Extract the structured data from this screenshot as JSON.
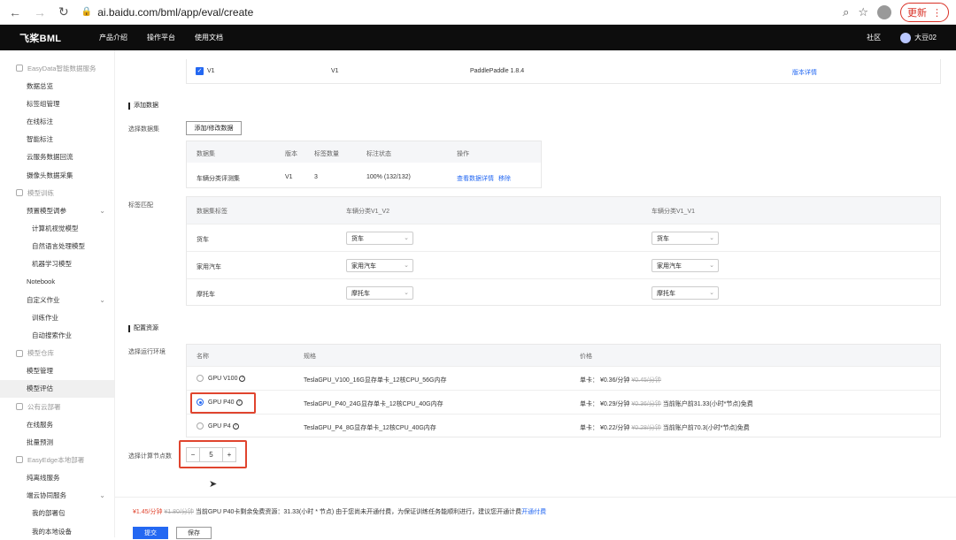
{
  "browser": {
    "url": "ai.baidu.com/bml/app/eval/create",
    "update_label": "更新"
  },
  "topbar": {
    "logo": "飞桨BML",
    "menu": [
      "产品介绍",
      "操作平台",
      "使用文档"
    ],
    "community": "社区",
    "user": "大豆02"
  },
  "sidebar": {
    "items": [
      {
        "type": "group",
        "label": "EasyData智能数据服务"
      },
      {
        "type": "item",
        "label": "数据总览"
      },
      {
        "type": "item",
        "label": "标签组管理"
      },
      {
        "type": "item",
        "label": "在线标注"
      },
      {
        "type": "item",
        "label": "智能标注"
      },
      {
        "type": "item",
        "label": "云服务数据回流"
      },
      {
        "type": "item",
        "label": "摄像头数据采集"
      },
      {
        "type": "group",
        "label": "模型训练"
      },
      {
        "type": "item",
        "label": "预置模型调参",
        "chevron": true
      },
      {
        "type": "sub",
        "label": "计算机视觉模型"
      },
      {
        "type": "sub",
        "label": "自然语言处理模型"
      },
      {
        "type": "sub",
        "label": "机器学习模型"
      },
      {
        "type": "item",
        "label": "Notebook"
      },
      {
        "type": "item",
        "label": "自定义作业",
        "chevron": true
      },
      {
        "type": "sub",
        "label": "训练作业"
      },
      {
        "type": "sub",
        "label": "自动搜索作业"
      },
      {
        "type": "group",
        "label": "模型仓库"
      },
      {
        "type": "item",
        "label": "模型管理"
      },
      {
        "type": "item",
        "label": "模型评估",
        "active": true
      },
      {
        "type": "group",
        "label": "公有云部署"
      },
      {
        "type": "item",
        "label": "在线服务"
      },
      {
        "type": "item",
        "label": "批量预测"
      },
      {
        "type": "group",
        "label": "EasyEdge本地部署"
      },
      {
        "type": "item",
        "label": "纯离线服务"
      },
      {
        "type": "item",
        "label": "端云协同服务",
        "chevron": true
      },
      {
        "type": "sub",
        "label": "我的部署包"
      },
      {
        "type": "sub",
        "label": "我的本地设备"
      }
    ]
  },
  "version_row": {
    "checked_label": "V1",
    "version": "V1",
    "framework": "PaddlePaddle 1.8.4",
    "detail_link": "版本详情"
  },
  "dataset_section": {
    "title": "添加数据",
    "select_label": "选择数据集",
    "add_button": "添加/修改数据",
    "headers": [
      "数据集",
      "版本",
      "标签数量",
      "标注状态",
      "操作"
    ],
    "row": {
      "name": "车辆分类评测集",
      "version": "V1",
      "count": "3",
      "status": "100% (132/132)",
      "view_link": "查看数据详情",
      "remove_link": "移除"
    }
  },
  "label_match": {
    "label": "标签匹配",
    "headers": [
      "数据集标签",
      "车辆分类V1_V2",
      "车辆分类V1_V1"
    ],
    "rows": [
      {
        "label": "货车",
        "v2": "货车",
        "v1": "货车"
      },
      {
        "label": "家用汽车",
        "v2": "家用汽车",
        "v1": "家用汽车"
      },
      {
        "label": "摩托车",
        "v2": "摩托车",
        "v1": "摩托车"
      }
    ]
  },
  "resource_section": {
    "title": "配置资源",
    "env_label": "选择运行环境",
    "headers": [
      "名称",
      "规格",
      "价格"
    ],
    "rows": [
      {
        "name": "GPU V100",
        "spec": "TeslaGPU_V100_16G显存单卡_12核CPU_56G内存",
        "unit": "单卡：",
        "price": "¥0.36/分钟",
        "old": "¥0.45/分钟",
        "note": "",
        "selected": false
      },
      {
        "name": "GPU P40",
        "spec": "TeslaGPU_P40_24G显存单卡_12核CPU_40G内存",
        "unit": "单卡：",
        "price": "¥0.29/分钟",
        "old": "¥0.36/分钟",
        "note": "当前账户前31.33(小时*节点)免费",
        "selected": true
      },
      {
        "name": "GPU P4",
        "spec": "TeslaGPU_P4_8G显存单卡_12核CPU_40G内存",
        "unit": "单卡：",
        "price": "¥0.22/分钟",
        "old": "¥0.28/分钟",
        "note": "当前账户前70.3(小时*节点)免费",
        "selected": false
      }
    ],
    "nodes_label": "选择计算节点数",
    "nodes_value": "5",
    "minus": "−",
    "plus": "+"
  },
  "footer": {
    "price": "¥1.45/分钟",
    "old_price": "¥1.80/分钟",
    "notice": "当前GPU P40卡剩余免费资源：31.33(小时 * 节点) 由于您尚未开通付费，为保证训练任务能顺利进行，建议您开通计费",
    "notice_link": "开通付费",
    "submit": "提交",
    "save": "保存"
  }
}
